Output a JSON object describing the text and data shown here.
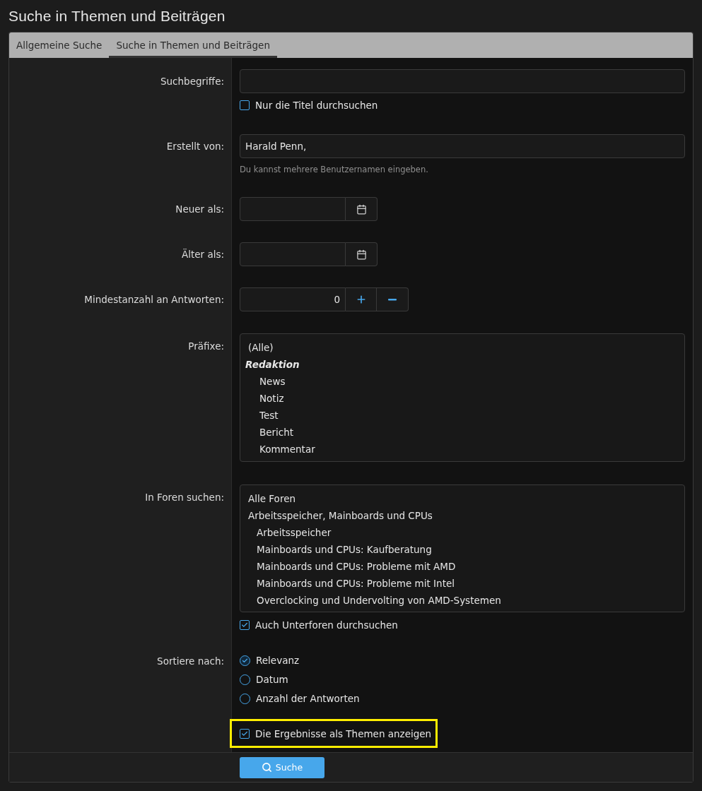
{
  "page_title": "Suche in Themen und Beiträgen",
  "tabs": [
    {
      "label": "Allgemeine Suche",
      "selected": false
    },
    {
      "label": "Suche in Themen und Beiträgen",
      "selected": true
    }
  ],
  "rows": [
    {
      "kind": "text",
      "label": "Suchbegriffe:",
      "option": {
        "label": "Nur die Titel durchsuchen",
        "checked": false
      }
    },
    {
      "kind": "text",
      "label": "Erstellt von:",
      "value": "Harald Penn,",
      "hint": "Du kannst mehrere Benutzernamen eingeben."
    },
    {
      "kind": "date",
      "label": "Neuer als:"
    },
    {
      "kind": "date",
      "label": "Älter als:"
    },
    {
      "kind": "number",
      "label": "Mindestanzahl an Antworten:",
      "value": "0"
    },
    {
      "kind": "list",
      "label": "Präfixe:",
      "items": [
        {
          "label": "(Alle)"
        },
        {
          "label": "Redaktion",
          "kind": "group",
          "children": [
            {
              "label": "News"
            },
            {
              "label": "Notiz"
            },
            {
              "label": "Test"
            },
            {
              "label": "Bericht"
            },
            {
              "label": "Kommentar"
            }
          ]
        }
      ]
    },
    {
      "kind": "list",
      "label": "In Foren suchen:",
      "items": [
        {
          "label": "Alle Foren"
        },
        {
          "label": "Arbeitsspeicher, Mainboards und CPUs",
          "children": [
            {
              "label": "Arbeitsspeicher"
            },
            {
              "label": "Mainboards und CPUs: Kaufberatung"
            },
            {
              "label": "Mainboards und CPUs: Probleme mit AMD"
            },
            {
              "label": "Mainboards und CPUs: Probleme mit Intel"
            },
            {
              "label": "Overclocking und Undervolting von AMD-Systemen"
            }
          ]
        }
      ],
      "option": {
        "label": "Auch Unterforen durchsuchen",
        "checked": true
      }
    },
    {
      "kind": "radio",
      "label": "Sortiere nach:",
      "options": [
        {
          "label": "Relevanz",
          "selected": true
        },
        {
          "label": "Datum",
          "selected": false
        },
        {
          "label": "Anzahl der Antworten",
          "selected": false
        }
      ]
    },
    {
      "kind": "checkbox",
      "option": {
        "label": "Die Ergebnisse als Themen anzeigen",
        "checked": true,
        "highlighted": true
      }
    }
  ],
  "submit": {
    "label": "Suche"
  }
}
